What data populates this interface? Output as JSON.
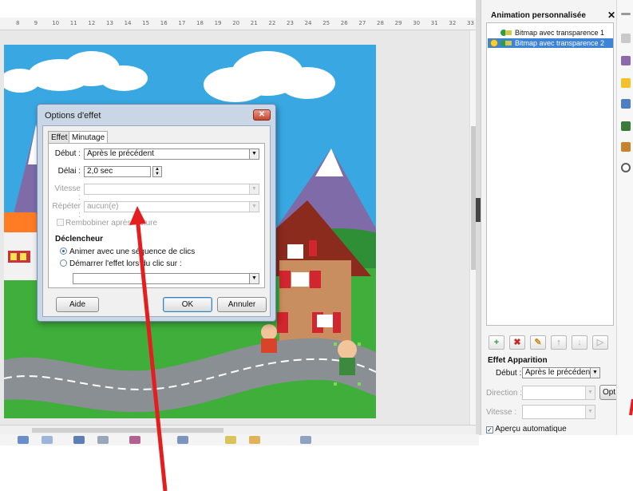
{
  "ruler": {
    "labels": [
      "8",
      "9",
      "10",
      "11",
      "12",
      "13",
      "14",
      "15",
      "16",
      "17",
      "18",
      "19",
      "20",
      "21",
      "22",
      "23",
      "24",
      "25",
      "26",
      "27",
      "28",
      "29",
      "30",
      "31",
      "32",
      "33"
    ]
  },
  "dialog": {
    "title": "Options d'effet",
    "close_glyph": "✕",
    "tabs": [
      {
        "label": "Effet"
      },
      {
        "label": "Minutage"
      }
    ],
    "debut": {
      "label": "Début :",
      "value": "Après le précédent"
    },
    "delai": {
      "label": "Délai :",
      "value": "2,0 sec"
    },
    "vitesse": {
      "label": "Vitesse :",
      "value": ""
    },
    "repeter": {
      "label": "Répéter :",
      "value": "aucun(e)"
    },
    "rembobiner": {
      "label": "Rembobiner après lecture"
    },
    "declencheur": {
      "title": "Déclencheur"
    },
    "radio1": {
      "label": "Animer avec une séquence de clics",
      "checked": true
    },
    "radio2": {
      "label": "Démarrer l'effet lors du clic sur :",
      "checked": false
    },
    "target_value": "",
    "buttons": {
      "aide": "Aide",
      "ok": "OK",
      "annuler": "Annuler"
    }
  },
  "panel": {
    "title": "Animation personnalisée",
    "close_glyph": "✕",
    "items": [
      {
        "label": "Bitmap avec transparence 1",
        "selected": false
      },
      {
        "label": "Bitmap avec transparence 2",
        "selected": true
      }
    ],
    "effet_title": "Effet Apparition",
    "debut": {
      "label": "Début :",
      "value": "Après le précédent"
    },
    "direction": {
      "label": "Direction :",
      "value": ""
    },
    "vitesse": {
      "label": "Vitesse :",
      "value": ""
    },
    "options_button": "Opt",
    "apercu": {
      "label": "Aperçu automatique",
      "checked": true
    }
  },
  "colors": {
    "sky": "#39a8e2",
    "grass": "#3fae3a",
    "road": "#8a8f94",
    "house_wall": "#c98e5f",
    "roof": "#8b2b1e",
    "shutter": "#d1252f",
    "annotation_arrow": "#e41e1e",
    "selection": "#3d84d6"
  }
}
